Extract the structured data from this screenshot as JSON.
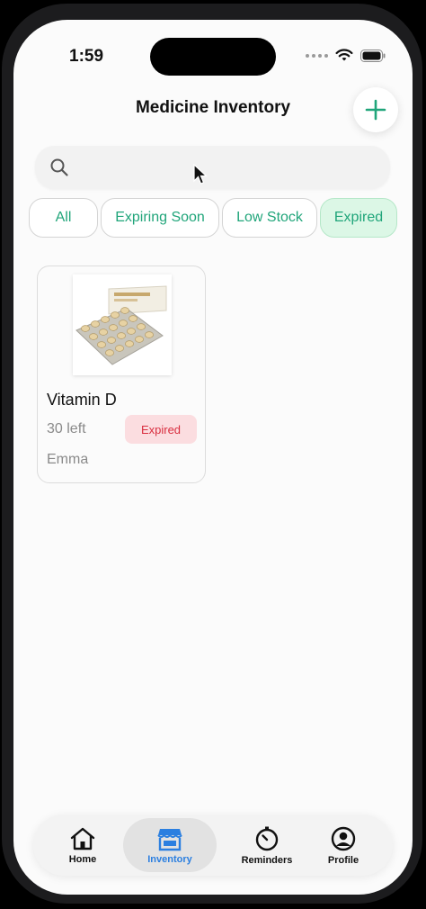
{
  "status": {
    "time": "1:59"
  },
  "header": {
    "title": "Medicine Inventory",
    "add_icon": "plus-icon"
  },
  "search": {
    "placeholder": "",
    "value": "",
    "icon": "search-icon"
  },
  "filters": [
    {
      "label": "All",
      "active": false
    },
    {
      "label": "Expiring Soon",
      "active": false
    },
    {
      "label": "Low Stock",
      "active": false
    },
    {
      "label": "Expired",
      "active": true
    }
  ],
  "items": [
    {
      "name": "Vitamin D",
      "quantity": "30 left",
      "status": "Expired",
      "owner": "Emma"
    }
  ],
  "tabbar": {
    "tabs": [
      {
        "label": "Home",
        "icon": "home-icon",
        "active": false
      },
      {
        "label": "Inventory",
        "icon": "store-icon",
        "active": true
      },
      {
        "label": "Reminders",
        "icon": "timer-icon",
        "active": false
      },
      {
        "label": "Profile",
        "icon": "profile-icon",
        "active": false
      }
    ]
  },
  "colors": {
    "accent_green": "#20a57a",
    "active_filter_bg": "#dcf7e6",
    "expired_badge_bg": "#fbdde0",
    "expired_badge_text": "#d92f40",
    "active_tab": "#2b7fe0"
  }
}
